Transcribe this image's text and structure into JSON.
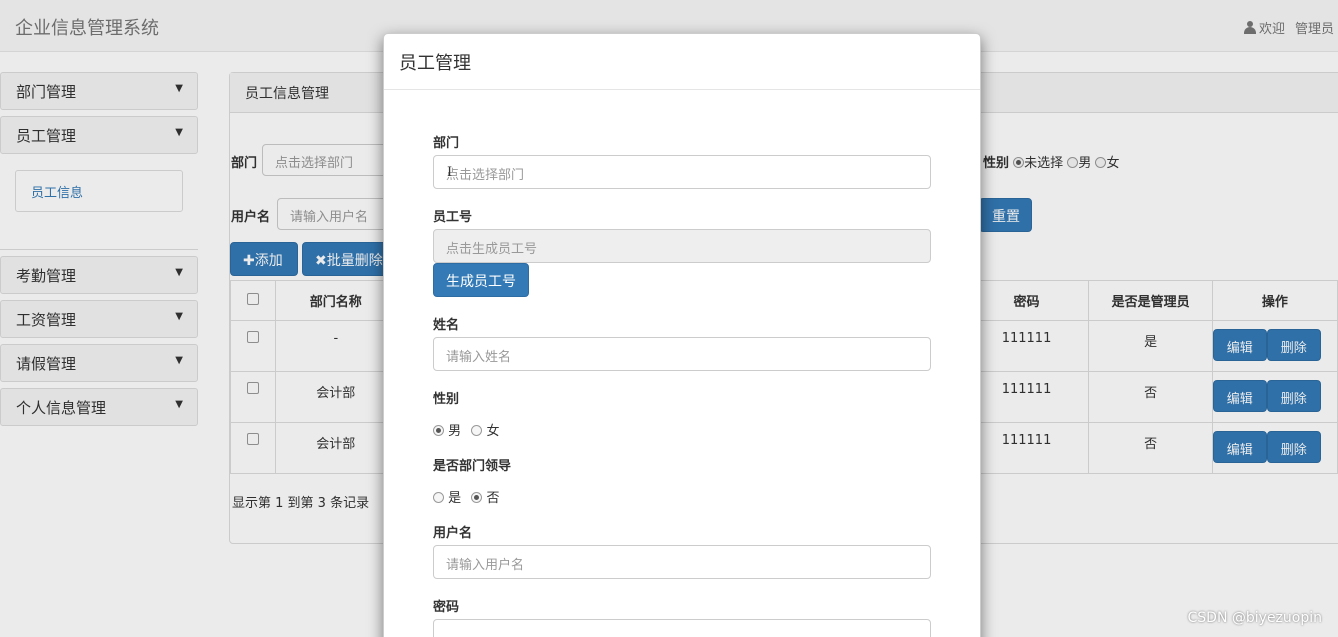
{
  "app": {
    "brand": "企业信息管理系统",
    "welcome": "欢迎",
    "user": "管理员"
  },
  "sidebar": {
    "items": [
      {
        "label": "部门管理"
      },
      {
        "label": "员工管理"
      },
      {
        "label": "考勤管理"
      },
      {
        "label": "工资管理"
      },
      {
        "label": "请假管理"
      },
      {
        "label": "个人信息管理"
      }
    ],
    "sub_item": "员工信息"
  },
  "panel": {
    "title": "员工信息管理",
    "filters": {
      "dept_label": "部门",
      "dept_placeholder": "点击选择部门",
      "username_label": "用户名",
      "username_placeholder": "请输入用户名",
      "gender_label": "性别",
      "gender_options": [
        "未选择",
        "男",
        "女"
      ]
    },
    "reset_button": "重置",
    "add_button": "添加",
    "batch_delete_button": "批量删除",
    "table": {
      "headers": {
        "dept": "部门名称",
        "password": "密码",
        "is_admin": "是否是管理员",
        "actions": "操作"
      },
      "rows": [
        {
          "dept": "-",
          "password": "111111",
          "is_admin": "是"
        },
        {
          "dept": "会计部",
          "password": "111111",
          "is_admin": "否"
        },
        {
          "dept": "会计部",
          "password": "111111",
          "is_admin": "否"
        }
      ],
      "edit_label": "编辑",
      "delete_label": "删除"
    },
    "footer": "显示第 1 到第 3 条记录"
  },
  "modal": {
    "title": "员工管理",
    "dept_label": "部门",
    "dept_placeholder": "点击选择部门",
    "empno_label": "员工号",
    "empno_placeholder": "点击生成员工号",
    "generate_button": "生成员工号",
    "name_label": "姓名",
    "name_placeholder": "请输入姓名",
    "gender_label": "性别",
    "gender_male": "男",
    "gender_female": "女",
    "leader_label": "是否部门领导",
    "leader_yes": "是",
    "leader_no": "否",
    "username_label": "用户名",
    "username_placeholder": "请输入用户名",
    "password_label": "密码"
  },
  "watermark": "CSDN @biyezuopin",
  "icons": {
    "user": "user-icon",
    "caret": "caret-down-icon",
    "plus": "plus-icon",
    "times": "times-icon"
  },
  "colors": {
    "primary": "#337ab7",
    "primary_dark": "#2e6da4"
  }
}
